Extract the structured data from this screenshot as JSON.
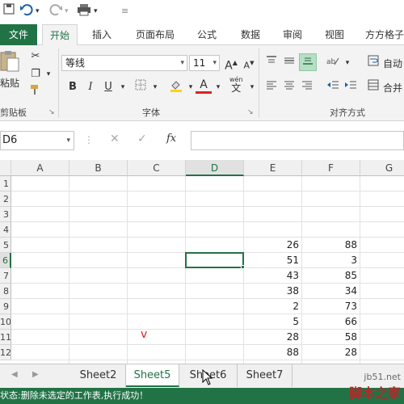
{
  "ribbon_tabs": {
    "file": "文件",
    "home": "开始",
    "insert": "插入",
    "layout": "页面布局",
    "formulas": "公式",
    "data": "数据",
    "review": "审阅",
    "view": "视图",
    "addin": "方方格子"
  },
  "clipboard": {
    "paste": "粘贴",
    "label": "剪贴板"
  },
  "font": {
    "name": "等线",
    "size": "11",
    "label": "字体",
    "grow": "A",
    "shrink": "A",
    "bold": "B",
    "italic": "I",
    "underline": "U",
    "font_color": "A",
    "phonetic_top": "wén",
    "phonetic_bottom": "文"
  },
  "alignment": {
    "label": "对齐方式",
    "wrap": "自动",
    "merge": "合并"
  },
  "formula_bar": {
    "name_box": "D6",
    "fx": "fx",
    "value": ""
  },
  "grid": {
    "columns": [
      "A",
      "B",
      "C",
      "D",
      "E",
      "F",
      "G"
    ],
    "rows": [
      "1",
      "2",
      "3",
      "4",
      "5",
      "6",
      "7",
      "8",
      "9",
      "10",
      "11",
      "12"
    ],
    "e_values": [
      "",
      "",
      "",
      "",
      "26",
      "51",
      "43",
      "38",
      "2",
      "5",
      "28",
      "88"
    ],
    "f_values": [
      "",
      "",
      "",
      "",
      "88",
      "3",
      "85",
      "34",
      "73",
      "66",
      "58",
      "28"
    ],
    "annotation_mark": "v"
  },
  "sheets": [
    "Sheet2",
    "Sheet5",
    "Sheet6",
    "Sheet7"
  ],
  "active_sheet": "Sheet5",
  "status": "状态:删除未选定的工作表,执行成功！",
  "watermark": {
    "line1": "jb51.net",
    "line2": "脚本之家"
  },
  "colors": {
    "accent": "#217346",
    "ribbon_bg": "#f3f3f3"
  }
}
